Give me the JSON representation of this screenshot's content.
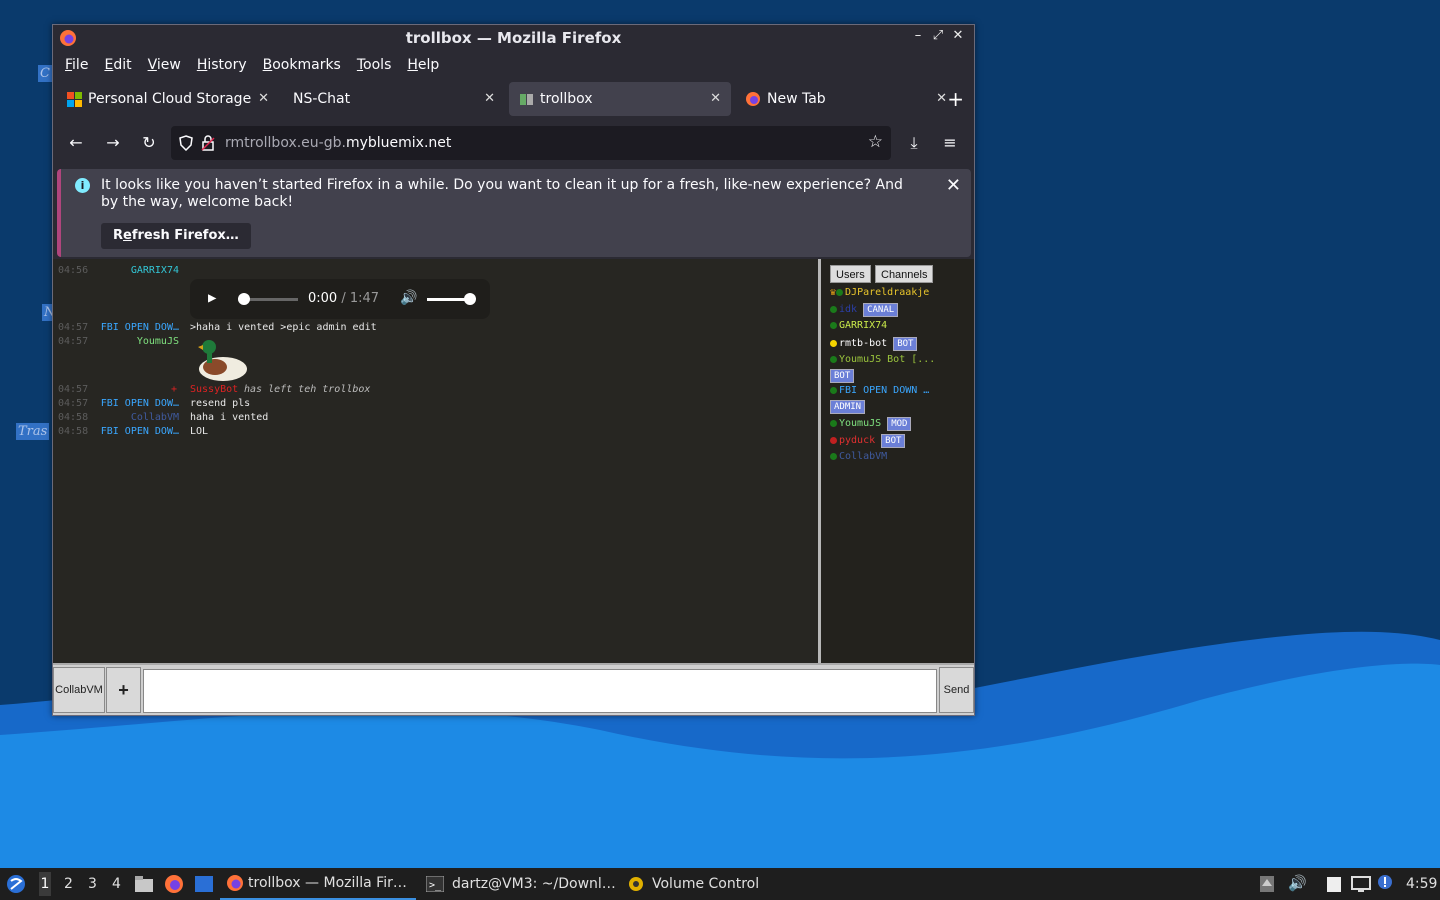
{
  "window": {
    "title": "trollbox — Mozilla Firefox",
    "controls": {
      "minimize": "–",
      "maximize": "⤢",
      "close": "✕"
    }
  },
  "menu": [
    "File",
    "Edit",
    "View",
    "History",
    "Bookmarks",
    "Tools",
    "Help"
  ],
  "tabs": [
    {
      "label": "Personal Cloud Storage",
      "icon": "windows-icon"
    },
    {
      "label": "NS-Chat",
      "icon": ""
    },
    {
      "label": "trollbox",
      "icon": "trollbox-icon",
      "active": true
    },
    {
      "label": "New Tab",
      "icon": "firefox-icon"
    }
  ],
  "url": {
    "prefix": "rmtrollbox.eu-gb.",
    "domain": "mybluemix.net"
  },
  "notification": {
    "message": "It looks like you haven’t started Firefox in a while. Do you want to clean it up for a fresh, like-new experience? And by the way, welcome back!",
    "button": "Refresh Firefox…"
  },
  "chat": {
    "messages": [
      {
        "time": "04:56",
        "nick": "GARRIX74",
        "text": "",
        "nick_color": "#33c6d6"
      },
      {
        "time": "04:57",
        "nick": "FBI OPEN DOW…",
        "text": ">haha i vented >epic admin edit",
        "nick_color": "#3aa7ff"
      },
      {
        "time": "04:57",
        "nick": "YoumuJS",
        "text": "",
        "nick_color": "#7fe07f"
      },
      {
        "time": "04:57",
        "nick": "SussyBot",
        "text": "has left teh trollbox",
        "nick_color": "#d22"
      },
      {
        "time": "04:57",
        "nick": "FBI OPEN DOW…",
        "text": "resend pls",
        "nick_color": "#3aa7ff"
      },
      {
        "time": "04:58",
        "nick": "CollabVM",
        "text": "haha i vented",
        "nick_color": "#3f5a9e"
      },
      {
        "time": "04:58",
        "nick": "FBI OPEN DOW…",
        "text": "LOL",
        "nick_color": "#3aa7ff"
      }
    ],
    "audio": {
      "current": "0:00",
      "separator": " / ",
      "duration": "1:47"
    },
    "leave_marker": "+"
  },
  "sidebar": {
    "tabs": [
      "Users",
      "Channels"
    ],
    "users": [
      {
        "name": "DJPareldraakje",
        "color": "#e8c52c",
        "badge": ""
      },
      {
        "name": "idk",
        "color": "#2b3fa8",
        "badge": "CANAL"
      },
      {
        "name": "GARRIX74",
        "color": "#c9e94a",
        "badge": ""
      },
      {
        "name": "rmtb-bot",
        "color": "#ffffff",
        "badge": "BOT"
      },
      {
        "name": "YoumuJS Bot [...",
        "color": "#9bc53d",
        "badge": "BOT"
      },
      {
        "name": "FBI OPEN DOWN …",
        "color": "#3aa7ff",
        "badge": "ADMIN"
      },
      {
        "name": "YoumuJS",
        "color": "#7fe07f",
        "badge": "MOD"
      },
      {
        "name": "pyduck",
        "color": "#e03030",
        "badge": "BOT"
      },
      {
        "name": "CollabVM",
        "color": "#3f5a9e",
        "badge": ""
      }
    ]
  },
  "input": {
    "channel_button": "CollabVM",
    "plus_button": "+",
    "send_button": "Send"
  },
  "desktop_icons": [
    "C",
    "N",
    "Tras"
  ],
  "taskbar": {
    "workspaces": [
      "1",
      "2",
      "3",
      "4"
    ],
    "tasks": [
      "trollbox — Mozilla Fir…",
      "dartz@VM3: ~/Downl…",
      "Volume Control"
    ],
    "clock": "4:59"
  }
}
